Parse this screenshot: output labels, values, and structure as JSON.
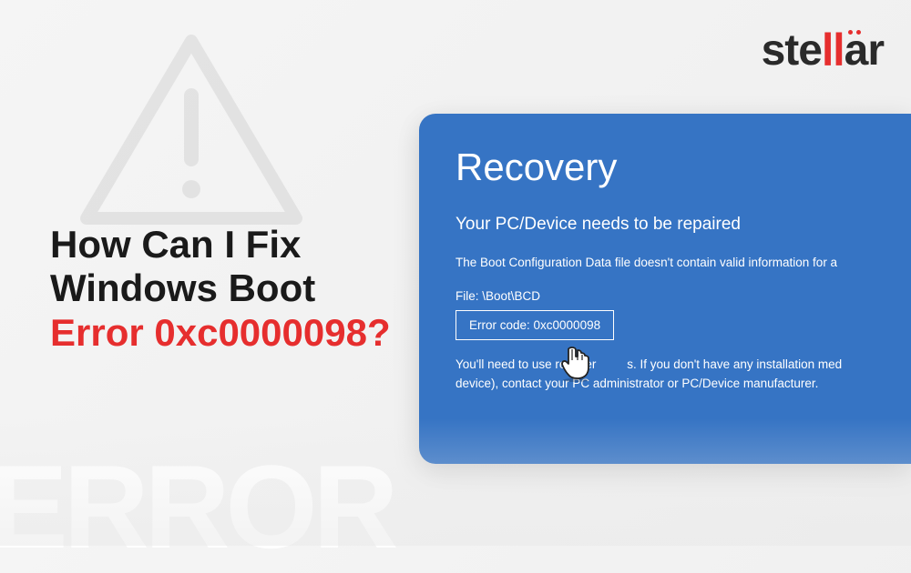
{
  "logo": {
    "part1": "ste",
    "part2": "ll",
    "part3": "ar"
  },
  "headline": {
    "line1": "How Can I Fix",
    "line2": "Windows Boot",
    "line3": "Error 0xc0000098?"
  },
  "recovery": {
    "title": "Recovery",
    "subtitle": "Your PC/Device needs to be repaired",
    "description": "The Boot Configuration Data file doesn't contain valid information for a",
    "file_label": "File: \\Boot\\BCD",
    "error_code": "Error code: 0xc0000098",
    "footer_line1": "You'll need to use recover",
    "footer_line2": "s. If you don't have any installation med",
    "footer_line3": "device), contact your PC administrator or PC/Device manufacturer."
  },
  "background_text": "ERROR"
}
